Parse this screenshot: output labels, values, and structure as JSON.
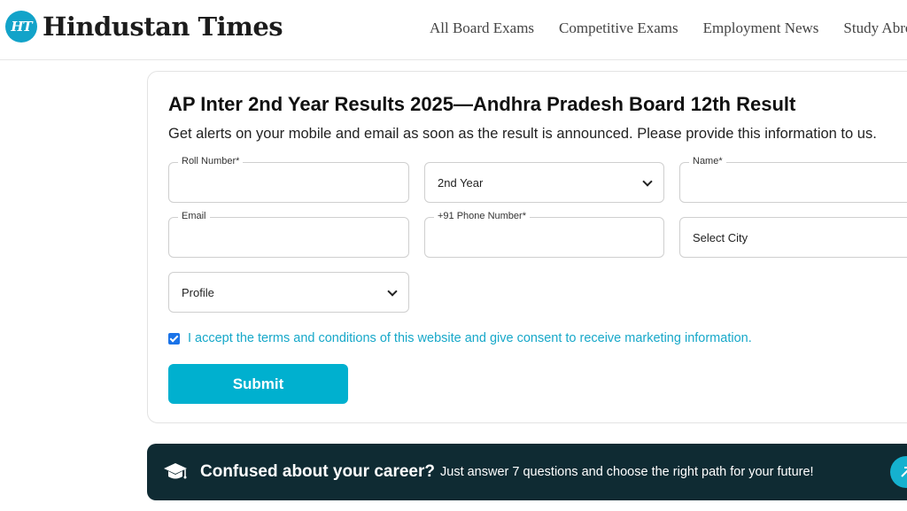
{
  "header": {
    "logo_badge": "HT",
    "logo_text": "Hindustan Times",
    "nav": [
      {
        "label": "All Board Exams"
      },
      {
        "label": "Competitive Exams"
      },
      {
        "label": "Employment News"
      },
      {
        "label": "Study Abroad"
      }
    ]
  },
  "form": {
    "title": "AP Inter 2nd Year Results 2025—Andhra Pradesh Board 12th Result",
    "subtitle": "Get alerts on your mobile and email as soon as the result is announced. Please provide this information to us.",
    "fields": {
      "roll_number": {
        "label": "Roll Number*",
        "value": ""
      },
      "year": {
        "selected": "2nd Year"
      },
      "name": {
        "label": "Name*",
        "value": ""
      },
      "email": {
        "label": "Email",
        "value": ""
      },
      "phone": {
        "label": "+91 Phone Number*",
        "value": ""
      },
      "city": {
        "selected": "Select City"
      },
      "profile": {
        "selected": "Profile"
      }
    },
    "consent": {
      "checked": true,
      "text": "I accept the terms and conditions of this website and give consent to receive marketing information."
    },
    "submit_label": "Submit"
  },
  "banner": {
    "headline": "Confused about your career?",
    "subtext": "Just answer 7 questions and choose the right path for your future!",
    "icon": "graduation-cap-icon",
    "action_icon": "arrow-up-right-icon"
  },
  "colors": {
    "brand": "#12a3c9",
    "submit": "#00b0cf",
    "consent_text": "#17a8c9",
    "banner_bg": "#0f2b33"
  }
}
